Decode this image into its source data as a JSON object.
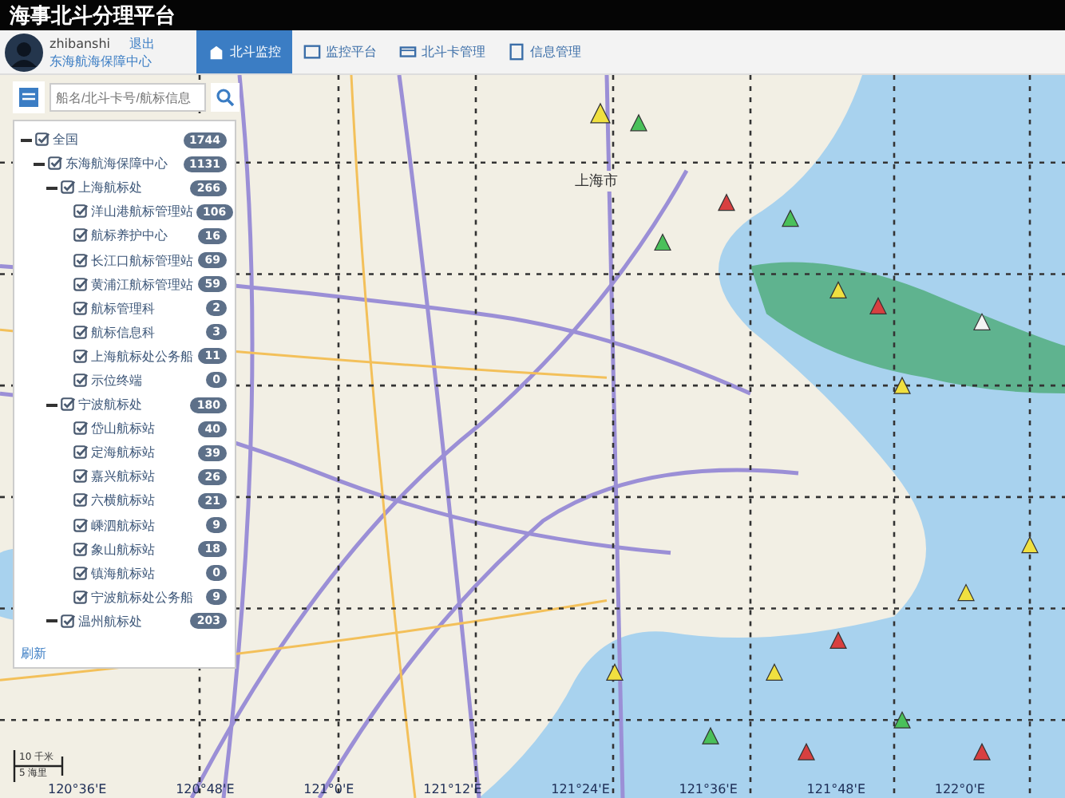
{
  "app": {
    "title": "海事北斗分理平台"
  },
  "user": {
    "name": "zhibanshi",
    "logout": "退出",
    "org": "东海航海保障中心"
  },
  "tabs": [
    {
      "label": "北斗监控",
      "selected": true
    },
    {
      "label": "监控平台",
      "selected": false
    },
    {
      "label": "北斗卡管理",
      "selected": false
    },
    {
      "label": "信息管理",
      "selected": false
    }
  ],
  "search": {
    "placeholder": "船名/北斗卡号/航标信息"
  },
  "tree": [
    {
      "label": "全国",
      "count": "1744",
      "checked": true,
      "expanded": true,
      "children": [
        {
          "label": "东海航海保障中心",
          "count": "1131",
          "checked": true,
          "expanded": true,
          "children": [
            {
              "label": "上海航标处",
              "count": "266",
              "checked": true,
              "expanded": true,
              "children": [
                {
                  "label": "洋山港航标管理站",
                  "count": "106",
                  "checked": true
                },
                {
                  "label": "航标养护中心",
                  "count": "16",
                  "checked": true
                },
                {
                  "label": "长江口航标管理站",
                  "count": "69",
                  "checked": true
                },
                {
                  "label": "黄浦江航标管理站",
                  "count": "59",
                  "checked": true
                },
                {
                  "label": "航标管理科",
                  "count": "2",
                  "checked": true
                },
                {
                  "label": "航标信息科",
                  "count": "3",
                  "checked": true
                },
                {
                  "label": "上海航标处公务船",
                  "count": "11",
                  "checked": true
                },
                {
                  "label": "示位终端",
                  "count": "0",
                  "checked": true
                }
              ]
            },
            {
              "label": "宁波航标处",
              "count": "180",
              "checked": true,
              "expanded": true,
              "children": [
                {
                  "label": "岱山航标站",
                  "count": "40",
                  "checked": true
                },
                {
                  "label": "定海航标站",
                  "count": "39",
                  "checked": true
                },
                {
                  "label": "嘉兴航标站",
                  "count": "26",
                  "checked": true
                },
                {
                  "label": "六横航标站",
                  "count": "21",
                  "checked": true
                },
                {
                  "label": "嵊泗航标站",
                  "count": "9",
                  "checked": true
                },
                {
                  "label": "象山航标站",
                  "count": "18",
                  "checked": true
                },
                {
                  "label": "镇海航标站",
                  "count": "0",
                  "checked": true
                },
                {
                  "label": "宁波航标处公务船",
                  "count": "9",
                  "checked": true
                }
              ]
            },
            {
              "label": "温州航标处",
              "count": "203",
              "checked": true,
              "expanded": true
            }
          ]
        }
      ]
    }
  ],
  "refresh": "刷新",
  "map": {
    "city_label": "上海市",
    "scale": {
      "distance": "10 千米",
      "nautical": "5 海里"
    },
    "longitude_labels": [
      "120°36'E",
      "120°48'E",
      "121°0'E",
      "121°12'E",
      "121°24'E",
      "121°36'E",
      "121°48'E",
      "122°0'E"
    ]
  }
}
